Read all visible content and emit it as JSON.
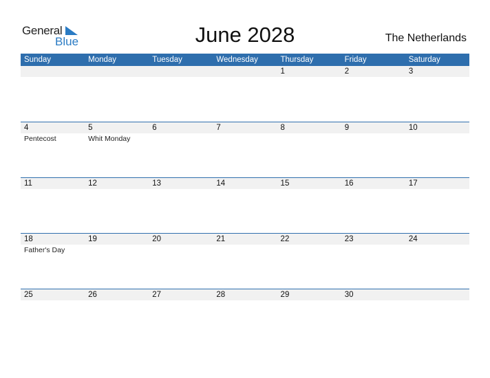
{
  "logo": {
    "line1": "General",
    "line2": "Blue"
  },
  "title": "June 2028",
  "country": "The Netherlands",
  "colors": {
    "accent": "#2e6ead",
    "strip": "#f1f1f1",
    "logo_blue": "#2a7bc4"
  },
  "weekdays": [
    "Sunday",
    "Monday",
    "Tuesday",
    "Wednesday",
    "Thursday",
    "Friday",
    "Saturday"
  ],
  "weeks": [
    [
      {
        "date": ""
      },
      {
        "date": ""
      },
      {
        "date": ""
      },
      {
        "date": ""
      },
      {
        "date": "1"
      },
      {
        "date": "2"
      },
      {
        "date": "3"
      }
    ],
    [
      {
        "date": "4",
        "holiday": "Pentecost"
      },
      {
        "date": "5",
        "holiday": "Whit Monday"
      },
      {
        "date": "6"
      },
      {
        "date": "7"
      },
      {
        "date": "8"
      },
      {
        "date": "9"
      },
      {
        "date": "10"
      }
    ],
    [
      {
        "date": "11"
      },
      {
        "date": "12"
      },
      {
        "date": "13"
      },
      {
        "date": "14"
      },
      {
        "date": "15"
      },
      {
        "date": "16"
      },
      {
        "date": "17"
      }
    ],
    [
      {
        "date": "18",
        "holiday": "Father's Day"
      },
      {
        "date": "19"
      },
      {
        "date": "20"
      },
      {
        "date": "21"
      },
      {
        "date": "22"
      },
      {
        "date": "23"
      },
      {
        "date": "24"
      }
    ],
    [
      {
        "date": "25"
      },
      {
        "date": "26"
      },
      {
        "date": "27"
      },
      {
        "date": "28"
      },
      {
        "date": "29"
      },
      {
        "date": "30"
      },
      {
        "date": ""
      }
    ]
  ]
}
